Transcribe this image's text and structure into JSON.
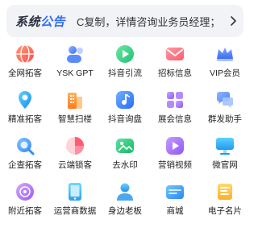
{
  "notice": {
    "title_part1": "系统",
    "title_part2": "公告",
    "text": "C复制，详情咨询业务员经理；"
  },
  "grid": {
    "items": [
      {
        "label": "全网拓客",
        "icon": "globe-icon"
      },
      {
        "label": "YSK GPT",
        "icon": "chatbot-icon"
      },
      {
        "label": "抖音引流",
        "icon": "play-icon"
      },
      {
        "label": "招标信息",
        "icon": "envelope-icon"
      },
      {
        "label": "VIP会员",
        "icon": "crown-icon"
      },
      {
        "label": "精准拓客",
        "icon": "location-icon"
      },
      {
        "label": "智慧扫楼",
        "icon": "building-icon"
      },
      {
        "label": "抖音询盘",
        "icon": "music-icon"
      },
      {
        "label": "展会信息",
        "icon": "grid-icon"
      },
      {
        "label": "群发助手",
        "icon": "chat-bubbles-icon"
      },
      {
        "label": "企查拓客",
        "icon": "search-icon"
      },
      {
        "label": "云端锁客",
        "icon": "pie-icon"
      },
      {
        "label": "去水印",
        "icon": "watermark-icon"
      },
      {
        "label": "营销视频",
        "icon": "video-icon"
      },
      {
        "label": "微官网",
        "icon": "monitor-icon"
      },
      {
        "label": "附近拓客",
        "icon": "nearby-icon"
      },
      {
        "label": "运营商数据",
        "icon": "phone-icon"
      },
      {
        "label": "身边老板",
        "icon": "person-icon"
      },
      {
        "label": "商城",
        "icon": "shop-icon"
      },
      {
        "label": "电子名片",
        "icon": "card-icon"
      }
    ]
  }
}
